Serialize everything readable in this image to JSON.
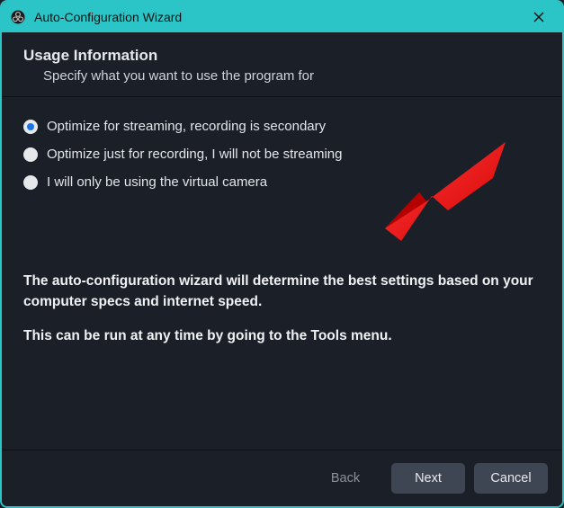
{
  "window": {
    "title": "Auto-Configuration Wizard"
  },
  "header": {
    "title": "Usage Information",
    "subtitle": "Specify what you want to use the program for"
  },
  "options": [
    {
      "label": "Optimize for streaming, recording is secondary",
      "selected": true
    },
    {
      "label": "Optimize just for recording, I will not be streaming",
      "selected": false
    },
    {
      "label": "I will only be using the virtual camera",
      "selected": false
    }
  ],
  "info": {
    "line1": "The auto-configuration wizard will determine the best settings based on your computer specs and internet speed.",
    "line2": "This can be run at any time by going to the Tools menu."
  },
  "buttons": {
    "back": "Back",
    "next": "Next",
    "cancel": "Cancel"
  },
  "colors": {
    "accent": "#2cc5c7",
    "arrow": "#ff1a1a",
    "radio_dot": "#1a73e8"
  }
}
